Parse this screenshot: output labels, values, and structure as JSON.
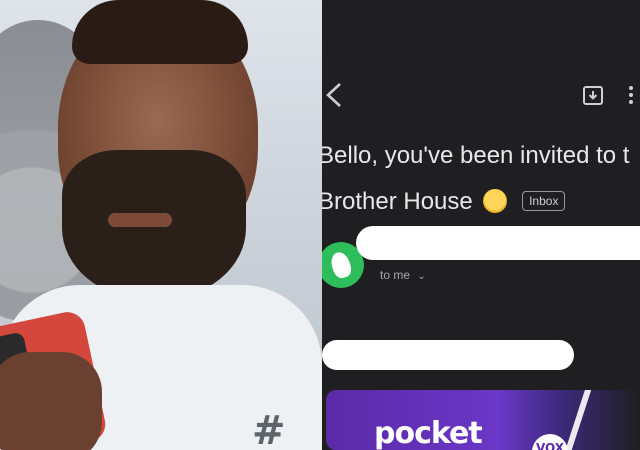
{
  "email": {
    "subject_line1": "Bello, you've been invited to",
    "subject_line1_clip": "t",
    "subject_line2": "Brother House",
    "badge": "Inbox",
    "recipient": "to me",
    "banner": {
      "logo_text": "pocket",
      "badge_text": "VOX"
    }
  },
  "photo": {
    "shirt_symbol": "#"
  },
  "colors": {
    "email_bg": "#1f1f21",
    "avatar_green": "#2ebd5b",
    "banner_purple": "#5b2aa8"
  },
  "icons": [
    "back-arrow-icon",
    "archive-icon",
    "more-icon",
    "emoji-icon",
    "chevron-down-icon"
  ]
}
